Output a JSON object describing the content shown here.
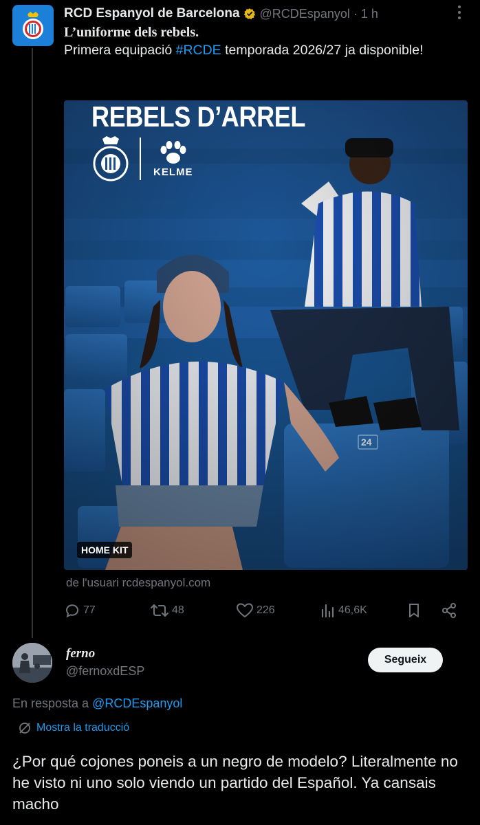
{
  "post": {
    "author_name": "RCD Espanyol de Barcelona",
    "handle": "@RCDEspanyol",
    "separator": "·",
    "time": "1 h",
    "title": "L’uniforme dels rebels.",
    "text_before": "Primera equipació ",
    "hashtag": "#RCDE",
    "text_after": " temporada 2026/27 ja disponible!",
    "media": {
      "headline": "REBELS D’ARREL",
      "brand_logo_text": "KELME",
      "badge": "HOME KIT"
    },
    "attribution": "de l'usuari rcdespanyol.com",
    "stats": {
      "replies": "77",
      "reposts": "48",
      "likes": "226",
      "views": "46,6K"
    }
  },
  "reply": {
    "name": "ferno",
    "handle": "@fernoxdESP",
    "follow_label": "Segueix",
    "reply_to_prefix": "En resposta a ",
    "reply_to_handle": "@RCDEspanyol",
    "translate_label": "Mostra la traducció",
    "body": "¿Por qué cojones poneis a un negro de modelo? Literalmente no he visto ni uno solo viendo un partido del Español. Ya cansais macho"
  },
  "colors": {
    "background": "#000000",
    "accent": "#1d9bf0",
    "secondary_text": "#71767b",
    "primary_text": "#e7e9ea",
    "espanyol_blue": "#1d80d8"
  }
}
